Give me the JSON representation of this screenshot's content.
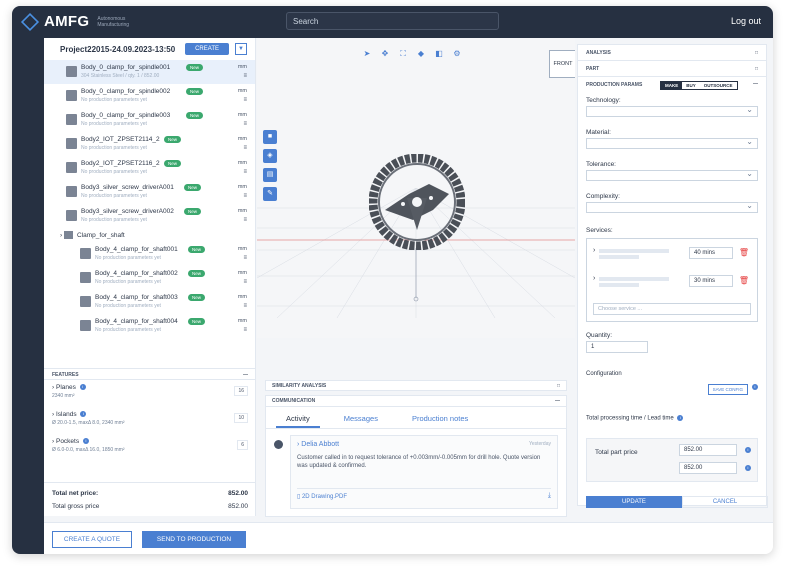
{
  "header": {
    "brand": "AMFG",
    "brand_sub": "Autonomous Manufacturing",
    "search_placeholder": "Search",
    "logout": "Log out"
  },
  "project": {
    "title": "Project22015-24.09.2023-13:50",
    "create_label": "CREATE",
    "dropdown_icon": "chevron-down-icon"
  },
  "tree": [
    {
      "name": "Body_0_clamp_for_spindle001",
      "sub": "304 Stainless Steel / qty. 1 / 852.00",
      "badge": "New",
      "unit": "mm"
    },
    {
      "name": "Body_0_clamp_for_spindle002",
      "sub": "No production parameters yet",
      "badge": "New",
      "unit": "mm"
    },
    {
      "name": "Body_0_clamp_for_spindle003",
      "sub": "No production parameters yet",
      "badge": "New",
      "unit": "mm"
    },
    {
      "name": "Body2_IOT_ZPSET2114_2",
      "sub": "No production parameters yet",
      "badge": "New",
      "unit": "mm"
    },
    {
      "name": "Body2_IOT_ZPSET2116_2",
      "sub": "No production parameters yet",
      "badge": "New",
      "unit": "mm"
    },
    {
      "name": "Body3_silver_screw_driverA001",
      "sub": "No production parameters yet",
      "badge": "New",
      "unit": "mm"
    },
    {
      "name": "Body3_silver_screw_driverA002",
      "sub": "No production parameters yet",
      "badge": "New",
      "unit": "mm"
    }
  ],
  "folder": {
    "name": "Clamp_for_shaft"
  },
  "subtree": [
    {
      "name": "Body_4_clamp_for_shaft001",
      "sub": "No production parameters yet",
      "badge": "New",
      "unit": "mm"
    },
    {
      "name": "Body_4_clamp_for_shaft002",
      "sub": "No production parameters yet",
      "badge": "New",
      "unit": "mm"
    },
    {
      "name": "Body_4_clamp_for_shaft003",
      "sub": "No production parameters yet",
      "badge": "New",
      "unit": "mm"
    },
    {
      "name": "Body_4_clamp_for_shaft004",
      "sub": "No production parameters yet",
      "badge": "New",
      "unit": "mm"
    }
  ],
  "features": {
    "title": "FEATURES",
    "items": [
      {
        "name": "Planes",
        "value": "2340 mm²",
        "count": "16"
      },
      {
        "name": "Islands",
        "value": "Ø 20.0-1.5, maxΔ 8.0, 2340 mm²",
        "count": "10"
      },
      {
        "name": "Pockets",
        "value": "Ø 6.0-0.0, maxΔ 16.0, 1850 mm²",
        "count": "6"
      }
    ]
  },
  "totals": {
    "net_label": "Total net price:",
    "net_value": "852.00",
    "gross_label": "Total gross price",
    "gross_value": "852.00"
  },
  "actions": {
    "quote": "CREATE A QUOTE",
    "send": "SEND TO PRODUCTION"
  },
  "viewer": {
    "cube_label": "FRONT"
  },
  "similarity": {
    "title": "SIMILARITY ANALYSIS"
  },
  "communication": {
    "title": "COMMUNICATION",
    "tabs": [
      "Activity",
      "Messages",
      "Production notes"
    ],
    "message": {
      "author": "Delia Abbott",
      "time": "Yesterday",
      "text": "Customer called in to request tolerance of +0.003mm/-0.005mm for drill hole. Quote version was updated & confirmed.",
      "file": "2D Drawing.PDF"
    }
  },
  "right": {
    "analysis": "ANALYSIS",
    "part": "PART",
    "production_params": "PRODUCTION PARAMS",
    "modes": [
      "MAKE",
      "BUY",
      "OUTSOURCE"
    ],
    "technology_label": "Technology:",
    "material_label": "Material:",
    "tolerance_label": "Tolerance:",
    "complexity_label": "Complexity:",
    "services_label": "Services:",
    "service_1_time": "40 mins",
    "service_2_time": "30 mins",
    "service_placeholder": "Choose service ...",
    "quantity_label": "Quantity:",
    "quantity_value": "1",
    "configuration_label": "Configuration",
    "save_config": "SAVE CONFIG",
    "processing_label": "Total processing time / Lead time",
    "part_price_label": "Total part price",
    "price_1": "852.00",
    "price_2": "852.00",
    "update": "UPDATE",
    "cancel": "CANCEL"
  }
}
